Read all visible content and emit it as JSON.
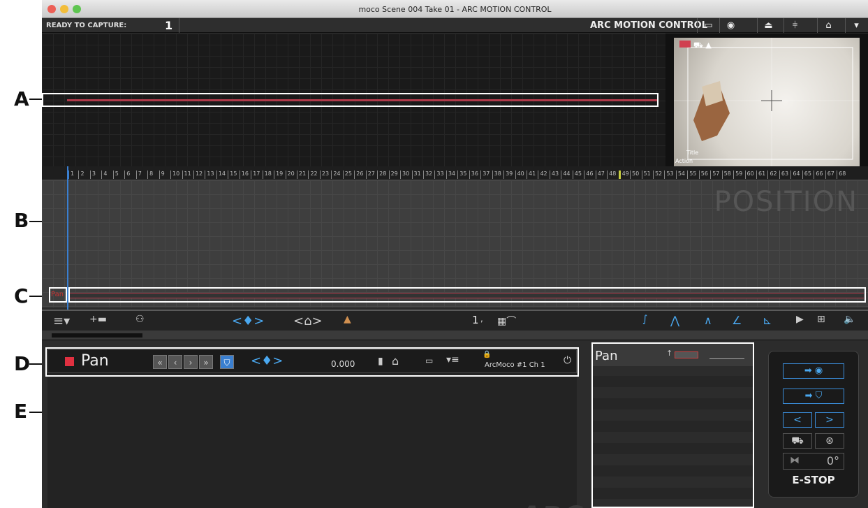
{
  "window": {
    "title": "moco  Scene 004  Take 01 - ARC MOTION CONTROL"
  },
  "status": {
    "label": "READY TO CAPTURE:",
    "count": "1",
    "brand": "ARC MOTION CONTROL"
  },
  "top_icons": [
    "monitor-icon",
    "camera-icon",
    "rig-icon",
    "waveform-icon",
    "route-icon",
    "dropdown-icon"
  ],
  "preview": {
    "label_top": "Title",
    "label_bottom": "Action"
  },
  "ruler": {
    "ticks": [
      "1",
      "2",
      "3",
      "4",
      "5",
      "6",
      "7",
      "8",
      "9",
      "10",
      "11",
      "12",
      "13",
      "14",
      "15",
      "16",
      "17",
      "18",
      "19",
      "20",
      "21",
      "22",
      "23",
      "24",
      "25",
      "26",
      "27",
      "28",
      "29",
      "30",
      "31",
      "32",
      "33",
      "34",
      "35",
      "36",
      "37",
      "38",
      "39",
      "40",
      "41",
      "42",
      "43",
      "44",
      "45",
      "46",
      "47",
      "48",
      "49",
      "50",
      "51",
      "52",
      "53",
      "54",
      "55",
      "56",
      "57",
      "58",
      "59",
      "60",
      "61",
      "62",
      "63",
      "64",
      "65",
      "66",
      "67",
      "68"
    ]
  },
  "position": {
    "title": "POSITION",
    "track_label": "Pan"
  },
  "toolbar": {
    "keyframe_nav": "<♦>",
    "home_nav": "<⌂>",
    "frame": "1",
    "frame_unit": ","
  },
  "axis": {
    "name": "Pan",
    "value": "0.000",
    "device": "ArcMoco #1 Ch 1",
    "nav_keys": "<♦>",
    "logo": "ARC"
  },
  "pan_panel": {
    "label": "Pan"
  },
  "estop": {
    "label": "E-STOP",
    "angle": "0°"
  },
  "callouts": {
    "a": "A",
    "b": "B",
    "c": "C",
    "d": "D",
    "e": "E"
  },
  "colors": {
    "accent": "#4aa8f0",
    "track_red": "#b03a4a",
    "axis_red": "#e03040"
  }
}
